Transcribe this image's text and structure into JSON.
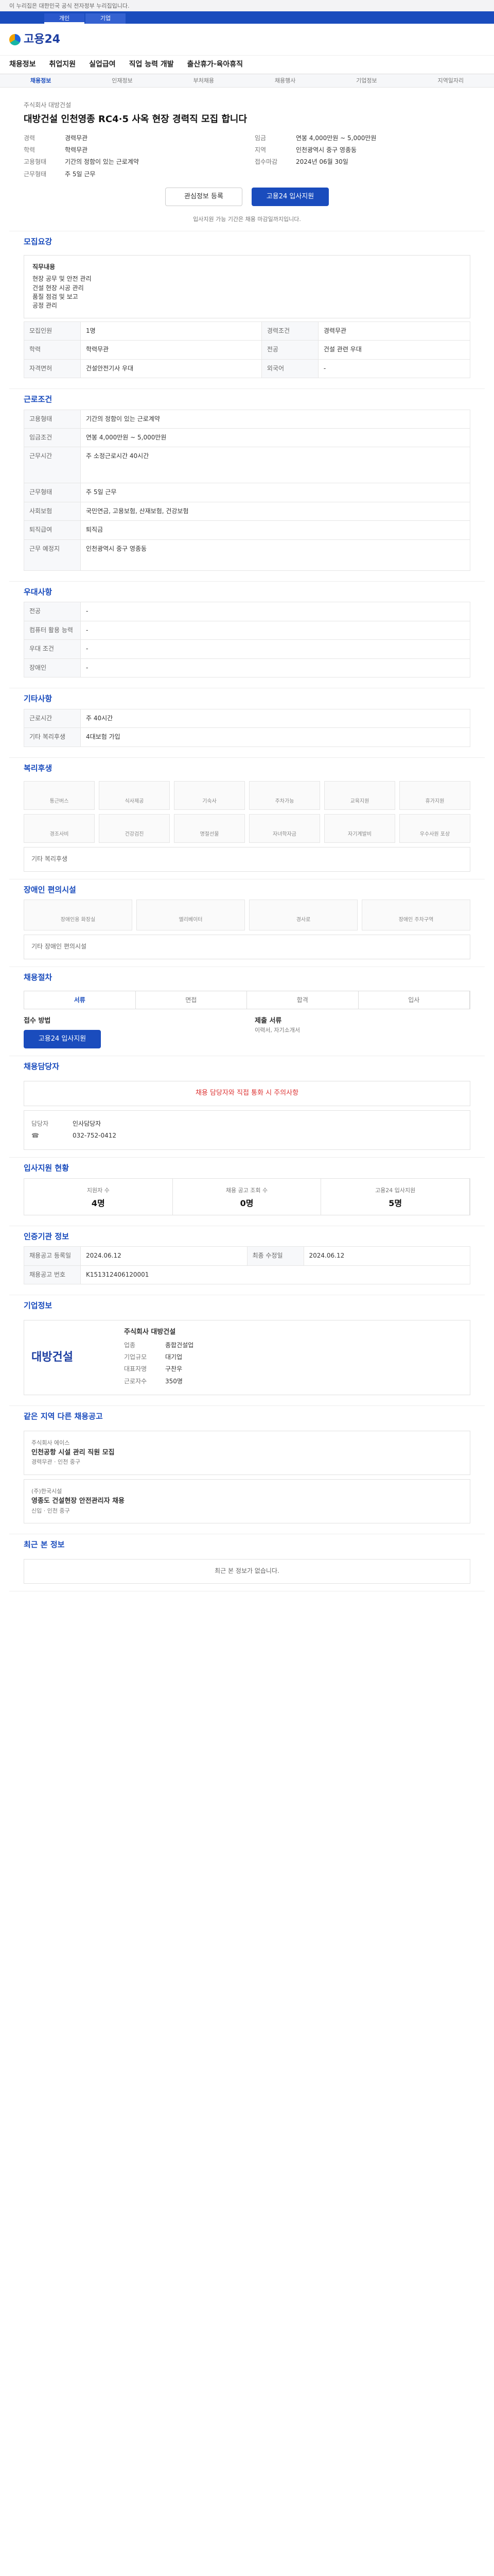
{
  "top": {
    "banner": "이 누리집은 대한민국 공식 전자정부 누리집입니다.",
    "tabs": [
      "개인",
      "기업"
    ]
  },
  "brand": {
    "logo": "고용24"
  },
  "gnb": [
    "채용정보",
    "취업지원",
    "실업급여",
    "직업 능력 개발",
    "출산휴가·육아휴직"
  ],
  "subnav": [
    "채용정보",
    "인재정보",
    "부처채용",
    "채용행사",
    "기업정보",
    "지역일자리"
  ],
  "job": {
    "company": "주식회사 대방건설",
    "title": "대방건설 인천영종 RC4·5 사옥 현장 경력직 모집 합니다",
    "loc_label": "근무지역",
    "left": [
      [
        "경력",
        "경력무관"
      ],
      [
        "학력",
        "학력무관"
      ],
      [
        "고용형태",
        "기간의 정함이 있는 근로계약"
      ],
      [
        "근무형태",
        "주 5일 근무"
      ]
    ],
    "right": [
      [
        "임금",
        "연봉 4,000만원 ~ 5,000만원"
      ],
      [
        "지역",
        "인천광역시 중구 영종동"
      ],
      [
        "접수마감",
        "2024년 06월 30일"
      ]
    ],
    "btn_scrap": "관심정보 등록",
    "btn_apply": "고용24 입사지원",
    "apply_note": "입사지원 가능 기간은 채용 마감일까지입니다."
  },
  "sections": {
    "recruit": "모집요강",
    "conditions": "근로조건",
    "benefits": "우대사항",
    "other": "기타사항",
    "welfare": "복리후생",
    "disabled": "장애인 편의시설",
    "process": "채용절차",
    "contact": "채용담당자",
    "applicant": "입사지원 현황",
    "info": "인증기관 정보",
    "company": "기업정보",
    "similar": "같은 지역 다른 채용공고",
    "recent": "최근 본 정보"
  },
  "recruit": {
    "job_label": "직무내용",
    "items": [
      "현장 공무 및 안전 관리",
      "건설 현장 시공 관리",
      "품질 점검 및 보고",
      "공정 관리"
    ],
    "rows": [
      [
        "모집인원",
        "1명"
      ],
      [
        "경력조건",
        "경력무관"
      ],
      [
        "학력",
        "학력무관"
      ],
      [
        "전공",
        "건설 관련 우대"
      ],
      [
        "자격면허",
        "건설안전기사 우대"
      ],
      [
        "외국어",
        "-"
      ]
    ]
  },
  "conditions": {
    "rows": [
      [
        "고용형태",
        "기간의 정함이 있는 근로계약"
      ],
      [
        "임금조건",
        "연봉 4,000만원 ~ 5,000만원"
      ],
      [
        "근무시간",
        "주 소정근로시간 40시간"
      ],
      [
        "근무형태",
        "주 5일 근무"
      ],
      [
        "사회보험",
        "국민연금, 고용보험, 산재보험, 건강보험"
      ],
      [
        "퇴직급여",
        "퇴직금"
      ],
      [
        "근무 예정지",
        "인천광역시 중구 영종동"
      ]
    ]
  },
  "benefits": {
    "rows": [
      [
        "전공",
        "-"
      ],
      [
        "컴퓨터 활용 능력",
        "-"
      ],
      [
        "우대 조건",
        "-"
      ],
      [
        "장애인",
        "-"
      ]
    ]
  },
  "other": {
    "rows": [
      [
        "근로시간",
        "주 40시간"
      ],
      [
        "기타 복리후생",
        "4대보험 가입"
      ]
    ]
  },
  "welfare": [
    "통근버스",
    "식사제공",
    "기숙사",
    "주차가능",
    "교육지원",
    "휴가지원",
    "경조사비",
    "건강검진",
    "명절선물",
    "자녀학자금",
    "자기계발비",
    "우수사원 포상"
  ],
  "welfare_text": "기타 복리후생",
  "disabled": [
    "장애인용 화장실",
    "엘리베이터",
    "경사로",
    "장애인 주차구역"
  ],
  "disabled_text": "기타 장애인 편의시설",
  "process": {
    "tabs": [
      "서류",
      "면접",
      "합격",
      "입사"
    ],
    "method": "고용24 입사지원",
    "method_label": "접수 방법",
    "doc_label": "제출 서류",
    "doc": "이력서, 자기소개서"
  },
  "contact": {
    "title": "채용 담당자와 직접 통화 시 주의사항",
    "name": "인사담당자",
    "phone": "032-752-0412",
    "manager_label": "담당자"
  },
  "applicant": {
    "stats": [
      [
        "지원자 수",
        "4명"
      ],
      [
        "채용 공고 조회 수",
        "0명"
      ],
      [
        "고용24 입사지원",
        "5명"
      ]
    ]
  },
  "info": {
    "rows": [
      [
        "채용공고 등록일",
        "2024.06.12"
      ],
      [
        "최종 수정일",
        "2024.06.12"
      ],
      [
        "채용공고 번호",
        "K151312406120001"
      ]
    ]
  },
  "companyinfo": {
    "logo": "대방건설",
    "name": "주식회사 대방건설",
    "rows": [
      [
        "업종",
        "종합건설업"
      ],
      [
        "기업규모",
        "대기업"
      ],
      [
        "대표자명",
        "구찬우"
      ],
      [
        "근로자수",
        "350명"
      ]
    ]
  },
  "similar": [
    {
      "company": "주식회사 에이스",
      "title": "인천공항 시설 관리 직원 모집",
      "meta": "경력무관 · 인천 중구"
    },
    {
      "company": "(주)한국시설",
      "title": "영종도 건설현장 안전관리자 채용",
      "meta": "신입 · 인천 중구"
    }
  ],
  "recent": {
    "text": "최근 본 정보가 없습니다."
  }
}
